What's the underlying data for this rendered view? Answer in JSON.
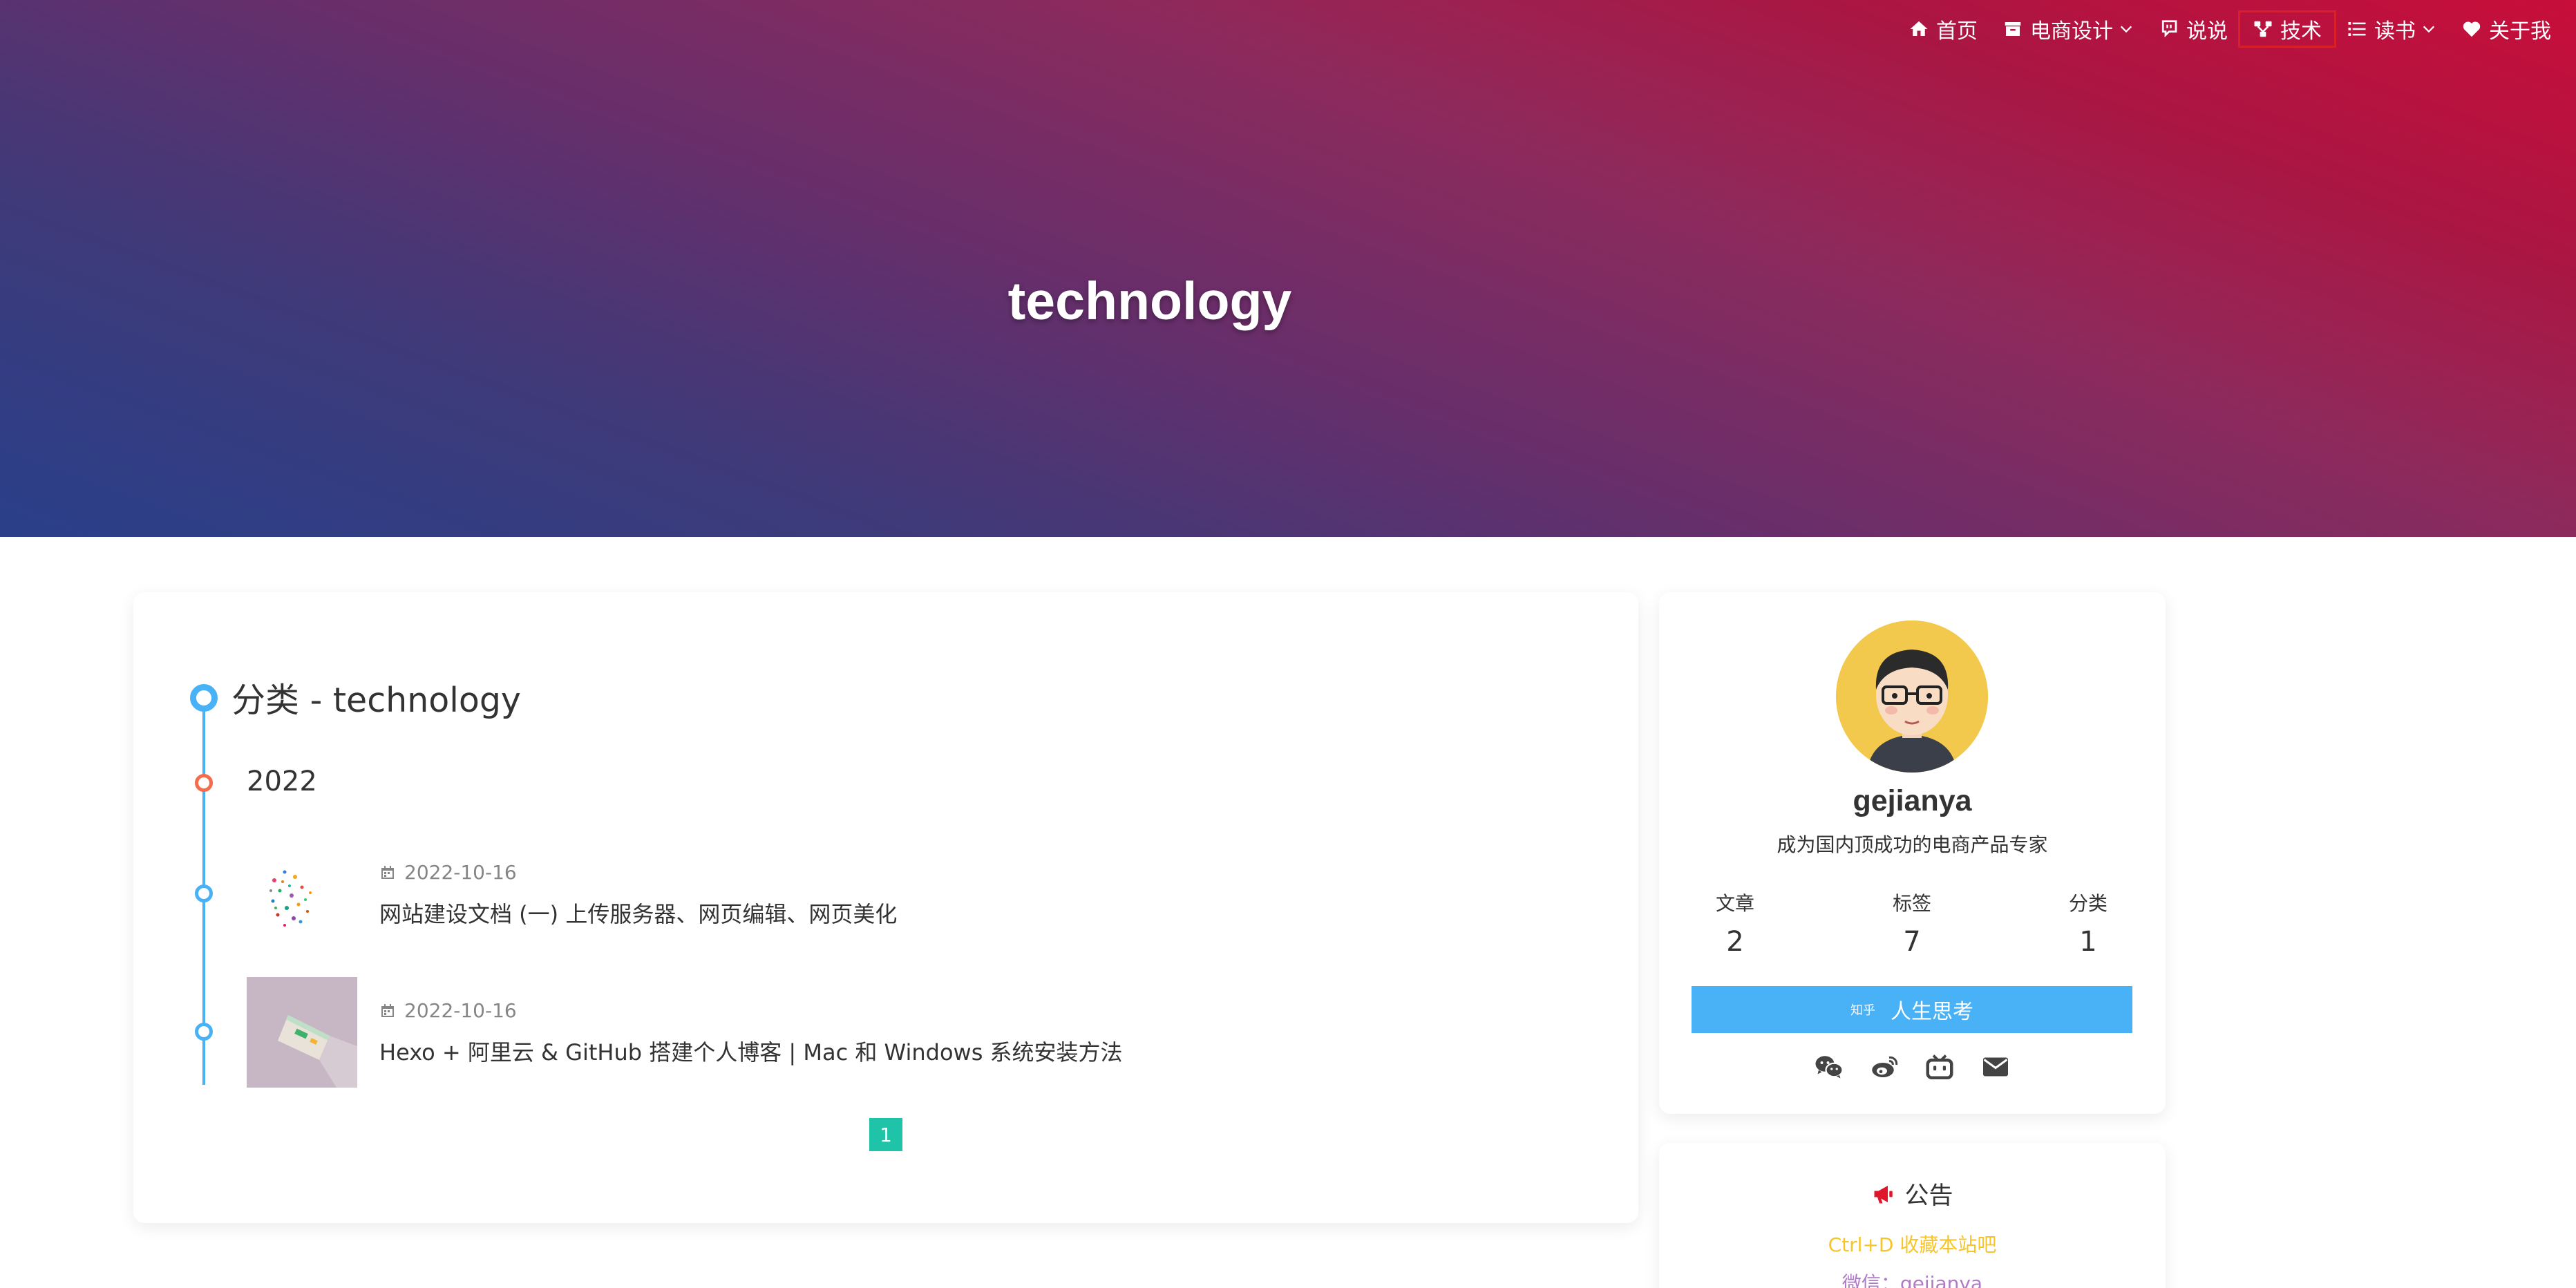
{
  "site": {
    "title": "technology"
  },
  "nav": {
    "items": [
      {
        "label": "首页",
        "icon": "home-icon"
      },
      {
        "label": "电商设计",
        "icon": "archive-icon",
        "dropdown": true
      },
      {
        "label": "说说",
        "icon": "comment-icon"
      },
      {
        "label": "技术",
        "icon": "sitemap-icon",
        "active": true
      },
      {
        "label": "读书",
        "icon": "list-icon",
        "dropdown": true
      },
      {
        "label": "关于我",
        "icon": "heart-icon"
      }
    ]
  },
  "main": {
    "category_title": "分类 - technology",
    "year": "2022",
    "posts": [
      {
        "date": "2022-10-16",
        "title": "网站建设文档 (一) 上传服务器、网页编辑、网页美化"
      },
      {
        "date": "2022-10-16",
        "title": "Hexo + 阿里云 & GitHub 搭建个人博客 | Mac 和 Windows 系统安装方法"
      }
    ],
    "pagination": {
      "current": "1"
    }
  },
  "author": {
    "name": "gejianya",
    "description": "成为国内顶成功的电商产品专家",
    "stats": [
      {
        "label": "文章",
        "value": "2"
      },
      {
        "label": "标签",
        "value": "7"
      },
      {
        "label": "分类",
        "value": "1"
      }
    ],
    "follow_button": {
      "prefix": "知乎",
      "label": "人生思考"
    },
    "social_icons": [
      "wechat-icon",
      "weibo-icon",
      "bilibili-icon",
      "envelope-icon"
    ]
  },
  "announcement": {
    "title": "公告",
    "line1": "Ctrl+D 收藏本站吧",
    "line2": "微信：gejianya"
  },
  "colors": {
    "accent": "#49b1f5",
    "year_dot": "#f56c4a",
    "pager": "#1fc4a8",
    "announcement_icon": "#e0162b"
  }
}
